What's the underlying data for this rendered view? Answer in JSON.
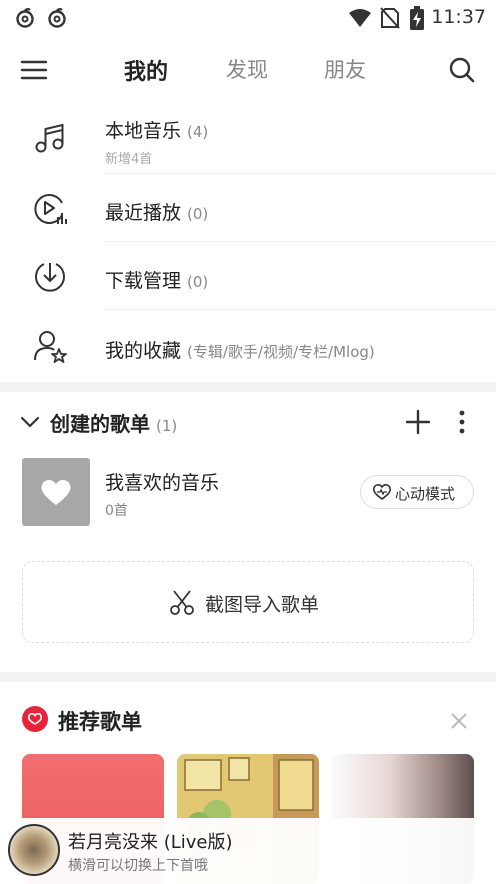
{
  "status_bar": {
    "time": "11:37",
    "icons": [
      "netease-cloud-icon",
      "netease-cloud-icon",
      "wifi-icon",
      "no-sim-icon",
      "battery-charging-icon"
    ]
  },
  "top_nav": {
    "tabs": [
      {
        "label": "我的",
        "active": true
      },
      {
        "label": "发现",
        "active": false
      },
      {
        "label": "朋友",
        "active": false
      }
    ]
  },
  "menu": {
    "items": [
      {
        "icon": "music-note-icon",
        "title": "本地音乐",
        "count": "(4)",
        "subtitle": "新增4首"
      },
      {
        "icon": "recent-play-icon",
        "title": "最近播放",
        "count": "(0)"
      },
      {
        "icon": "download-icon",
        "title": "下载管理",
        "count": "(0)"
      },
      {
        "icon": "user-star-icon",
        "title": "我的收藏",
        "count": "(专辑/歌手/视频/专栏/Mlog)"
      }
    ]
  },
  "created_playlists": {
    "title": "创建的歌单",
    "count": "(1)",
    "items": [
      {
        "title": "我喜欢的音乐",
        "count": "0首",
        "mode_button": "心动模式"
      }
    ],
    "import_label": "截图导入歌单"
  },
  "recommended": {
    "title": "推荐歌单"
  },
  "mini_player": {
    "title": "若月亮没来 (Live版)",
    "subtitle": "横滑可以切换上下首哦"
  },
  "colors": {
    "accent": "#e8243a",
    "text_primary": "#222222",
    "text_secondary": "#888888"
  }
}
